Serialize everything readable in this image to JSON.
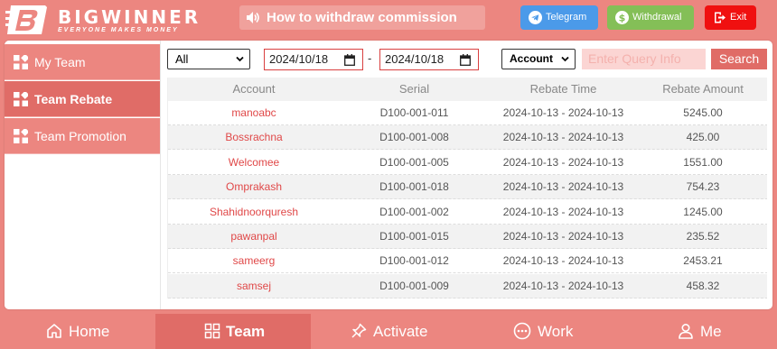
{
  "brand": {
    "name": "BIGWINNER",
    "tagline": "EVERYONE MAKES MONEY"
  },
  "notice": {
    "text": "How to withdraw commission"
  },
  "header_buttons": {
    "telegram": "Telegram",
    "withdrawal": "Withdrawal",
    "exit": "Exit"
  },
  "sidebar": {
    "items": [
      {
        "label": "My Team",
        "icon": "grid-icon"
      },
      {
        "label": "Team Rebate",
        "icon": "grid-icon",
        "active": true
      },
      {
        "label": "Team Promotion",
        "icon": "grid-icon"
      }
    ]
  },
  "filters": {
    "range_select": "All",
    "date_from": "2024/10/18",
    "date_separator": "-",
    "date_to": "2024/10/18",
    "field_select": "Account",
    "query_placeholder": "Enter Query Info",
    "search_label": "Search"
  },
  "table": {
    "headers": [
      "Account",
      "Serial",
      "Rebate Time",
      "Rebate Amount"
    ],
    "rows": [
      [
        "manoabc",
        "D100-001-011",
        "2024-10-13 - 2024-10-13",
        "5245.00"
      ],
      [
        "Bossrachna",
        "D100-001-008",
        "2024-10-13 - 2024-10-13",
        "425.00"
      ],
      [
        "Welcomee",
        "D100-001-005",
        "2024-10-13 - 2024-10-13",
        "1551.00"
      ],
      [
        "Omprakash",
        "D100-001-018",
        "2024-10-13 - 2024-10-13",
        "754.23"
      ],
      [
        "Shahidnoorquresh",
        "D100-001-002",
        "2024-10-13 - 2024-10-13",
        "1245.00"
      ],
      [
        "pawanpal",
        "D100-001-015",
        "2024-10-13 - 2024-10-13",
        "235.52"
      ],
      [
        "sameerg",
        "D100-001-012",
        "2024-10-13 - 2024-10-13",
        "2453.21"
      ],
      [
        "samsej",
        "D100-001-009",
        "2024-10-13 - 2024-10-13",
        "458.32"
      ]
    ]
  },
  "bottom_nav": {
    "items": [
      {
        "label": "Home",
        "icon": "home-icon"
      },
      {
        "label": "Team",
        "icon": "grid-icon",
        "active": true
      },
      {
        "label": "Activate",
        "icon": "pin-icon"
      },
      {
        "label": "Work",
        "icon": "dots-circle-icon"
      },
      {
        "label": "Me",
        "icon": "user-icon"
      }
    ]
  },
  "colors": {
    "primary": "#ec8680",
    "active": "#e06c67",
    "telegram": "#4b9ae9",
    "withdrawal": "#84bf57",
    "exit": "#f01010"
  }
}
